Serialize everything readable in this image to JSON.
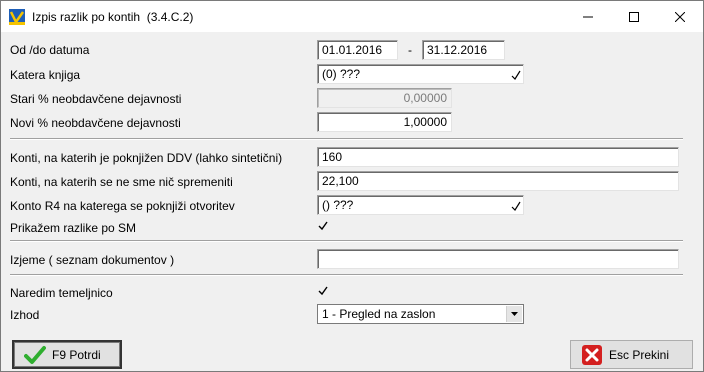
{
  "window": {
    "title": "Izpis razlik po kontih",
    "code": "(3.4.C.2)"
  },
  "form": {
    "date_label": "Od /do datuma",
    "date_from": "01.01.2016",
    "date_sep": "-",
    "date_to": "31.12.2016",
    "book_label": "Katera knjiga",
    "book_value": "(0) ???",
    "old_pct_label": "Stari % neobdavčene dejavnosti",
    "old_pct_value": "0,00000",
    "new_pct_label": "Novi % neobdavčene dejavnosti",
    "new_pct_value": "1,00000",
    "konti_ddv_label": "Konti, na katerih je poknjižen DDV (lahko sintetični)",
    "konti_ddv_value": "160",
    "konti_nospr_label": "Konti, na katerih se ne sme nič spremeniti",
    "konti_nospr_value": "22,100",
    "konto_r4_label": "Konto R4 na katerega se poknjiži otvoritev",
    "konto_r4_value": "() ???",
    "show_sm_label": "Prikažem razlike po SM",
    "show_sm_checked": true,
    "exclude_label": "Izjeme ( seznam dokumentov )",
    "exclude_value": "",
    "journal_label": "Naredim temeljnico",
    "journal_checked": true,
    "output_label": "Izhod",
    "output_value": "1 - Pregled na zaslon"
  },
  "buttons": {
    "confirm": "F9 Potrdi",
    "cancel": "Esc Prekini"
  },
  "colors": {
    "confirm_icon": "#2fae2f",
    "cancel_icon": "#d42020"
  }
}
